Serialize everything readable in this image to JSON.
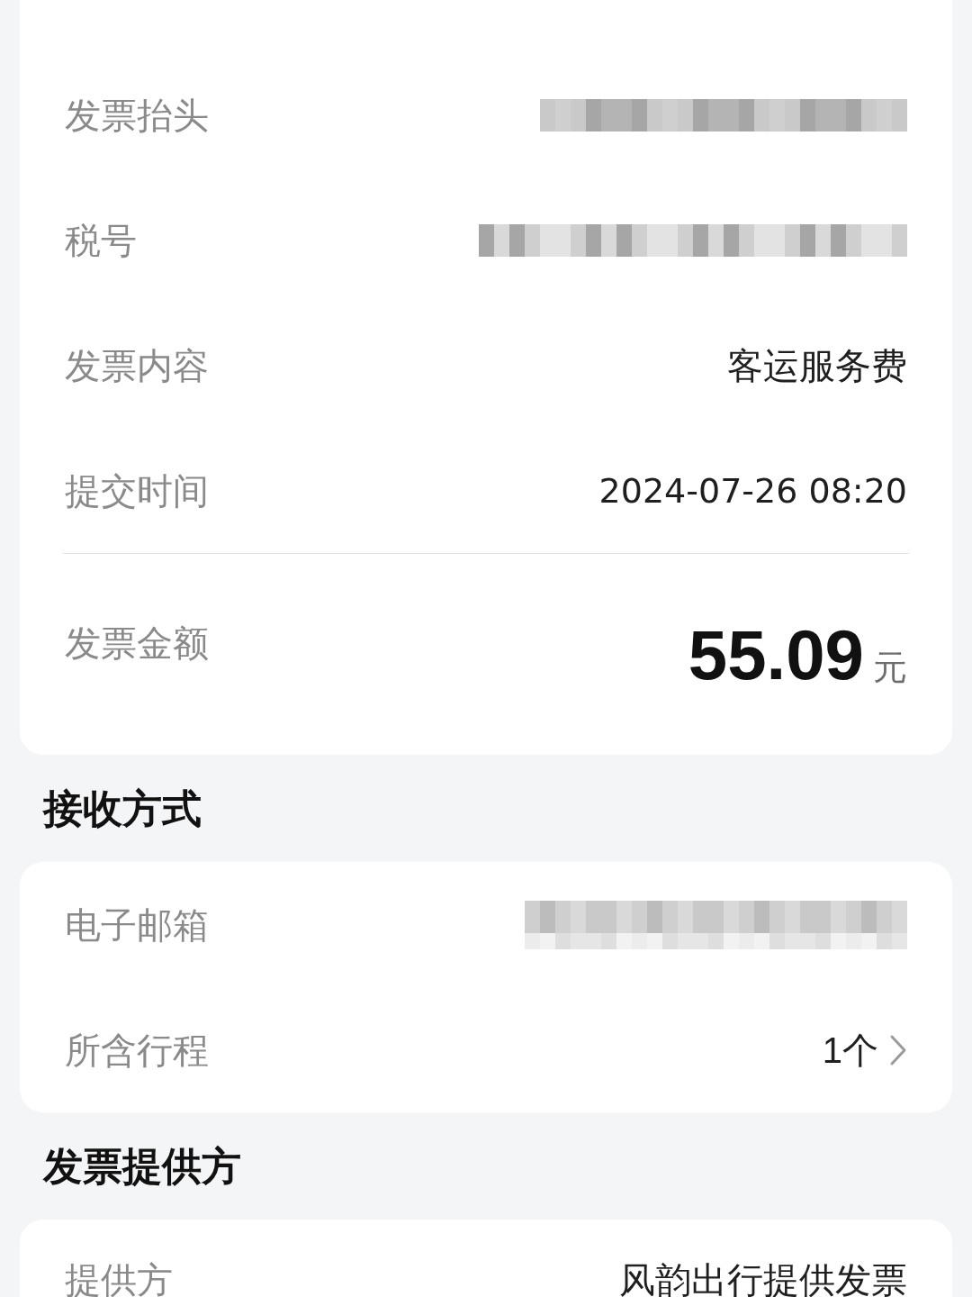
{
  "invoice_details": {
    "rows": [
      {
        "label": "发票抬头",
        "kind": "redacted"
      },
      {
        "label": "税号",
        "kind": "redacted"
      },
      {
        "label": "发票内容",
        "kind": "text",
        "value": "客运服务费"
      },
      {
        "label": "提交时间",
        "kind": "datetime",
        "value": "2024-07-26 08:20"
      }
    ],
    "amount": {
      "label": "发票金额",
      "value": "55.09",
      "unit": "元"
    }
  },
  "sections": [
    {
      "title": "接收方式",
      "rows": [
        {
          "label": "电子邮箱",
          "kind": "redacted"
        },
        {
          "label": "所含行程",
          "kind": "link",
          "value": "1个"
        }
      ]
    },
    {
      "title": "发票提供方",
      "rows": [
        {
          "label": "提供方",
          "kind": "text",
          "value": "风韵出行提供发票"
        }
      ]
    }
  ]
}
